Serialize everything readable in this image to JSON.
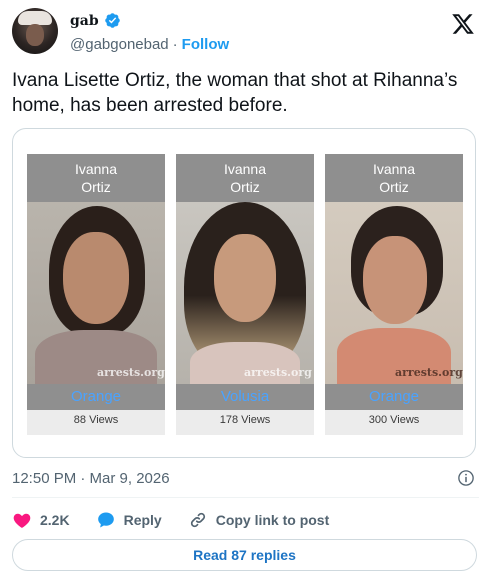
{
  "author": {
    "display_name": "gab",
    "handle": "@gabgonebad",
    "separator": "·",
    "follow_label": "Follow",
    "verified": true,
    "avatar_icon": "avatar-photo"
  },
  "platform_logo": "x-logo-icon",
  "tweet": {
    "text": "Ivana Lisette Ortiz, the woman that shot at Rihanna’s home, has been arrested before."
  },
  "mugshots": [
    {
      "first": "Ivanna",
      "last": "Ortiz",
      "county": "Orange",
      "views": "88 Views",
      "watermark": "arrests.org"
    },
    {
      "first": "Ivanna",
      "last": "Ortiz",
      "county": "Volusia",
      "views": "178 Views",
      "watermark": "arrests.org"
    },
    {
      "first": "Ivanna",
      "last": "Ortiz",
      "county": "Orange",
      "views": "300 Views",
      "watermark": "arrests.org"
    }
  ],
  "meta": {
    "timestamp": "12:50 PM · Mar 9, 2026"
  },
  "actions": {
    "likes": "2.2K",
    "reply_label": "Reply",
    "copy_link_label": "Copy link to post"
  },
  "footer": {
    "read_replies_label": "Read 87 replies"
  },
  "colors": {
    "accent": "#1d9bf0",
    "like": "#f91880",
    "reply_icon": "#1d9bf0",
    "county_text": "#4aa3ff",
    "label_bg": "#8f8f8f"
  }
}
